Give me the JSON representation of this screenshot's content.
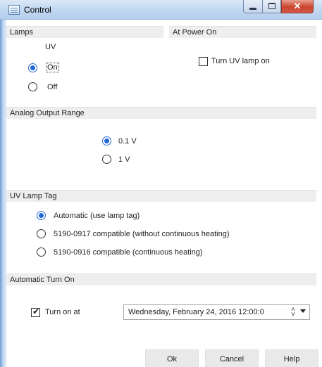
{
  "window": {
    "title": "Control"
  },
  "lamps": {
    "header": "Lamps",
    "column_label": "UV",
    "on_label": "On",
    "off_label": "Off",
    "selected": "On"
  },
  "power_on": {
    "header": "At Power On",
    "turn_uv_label": "Turn UV lamp on",
    "turn_uv_checked": false
  },
  "analog": {
    "header": "Analog Output Range",
    "options": [
      "0.1 V",
      "1 V"
    ],
    "selected": "0.1 V"
  },
  "lamp_tag": {
    "header": "UV Lamp Tag",
    "options": [
      "Automatic (use lamp tag)",
      "5190-0917 compatible (without continuous heating)",
      "5190-0916 compatible (continuous heating)"
    ],
    "selected": "Automatic (use lamp tag)"
  },
  "auto_on": {
    "header": "Automatic Turn On",
    "checkbox_label": "Turn on at",
    "checked": true,
    "datetime_value": "Wednesday,  February  24, 2016  12:00:0"
  },
  "buttons": {
    "ok": "Ok",
    "cancel": "Cancel",
    "help": "Help"
  }
}
